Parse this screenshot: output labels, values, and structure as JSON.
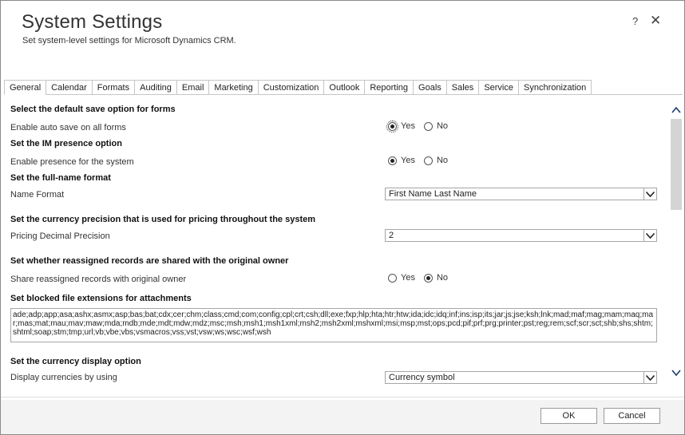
{
  "dialog": {
    "title": "System Settings",
    "subtitle": "Set system-level settings for Microsoft Dynamics CRM.",
    "help": "?",
    "close": "✕"
  },
  "tabs": [
    {
      "label": "General"
    },
    {
      "label": "Calendar"
    },
    {
      "label": "Formats"
    },
    {
      "label": "Auditing"
    },
    {
      "label": "Email"
    },
    {
      "label": "Marketing"
    },
    {
      "label": "Customization"
    },
    {
      "label": "Outlook"
    },
    {
      "label": "Reporting"
    },
    {
      "label": "Goals"
    },
    {
      "label": "Sales"
    },
    {
      "label": "Service"
    },
    {
      "label": "Synchronization"
    }
  ],
  "settings": {
    "autosave": {
      "heading": "Select the default save option for forms",
      "label": "Enable auto save on all forms",
      "yes": "Yes",
      "no": "No",
      "selected": "yes"
    },
    "presence": {
      "heading": "Set the IM presence option",
      "label": "Enable presence for the system",
      "yes": "Yes",
      "no": "No",
      "selected": "yes"
    },
    "fullname": {
      "heading": "Set the full-name format",
      "label": "Name Format",
      "value": "First Name Last Name"
    },
    "currency_precision": {
      "heading": "Set the currency precision that is used for pricing throughout the system",
      "label": "Pricing Decimal Precision",
      "value": "2"
    },
    "reassigned": {
      "heading": "Set whether reassigned records are shared with the original owner",
      "label": "Share reassigned records with original owner",
      "yes": "Yes",
      "no": "No",
      "selected": "no"
    },
    "blocked": {
      "heading": "Set blocked file extensions for attachments",
      "value": "ade;adp;app;asa;ashx;asmx;asp;bas;bat;cdx;cer;chm;class;cmd;com;config;cpl;crt;csh;dll;exe;fxp;hlp;hta;htr;htw;ida;idc;idq;inf;ins;isp;its;jar;js;jse;ksh;lnk;mad;maf;mag;mam;maq;mar;mas;mat;mau;mav;maw;mda;mdb;mde;mdt;mdw;mdz;msc;msh;msh1;msh1xml;msh2;msh2xml;mshxml;msi;msp;mst;ops;pcd;pif;prf;prg;printer;pst;reg;rem;scf;scr;sct;shb;shs;shtm;shtml;soap;stm;tmp;url;vb;vbe;vbs;vsmacros;vss;vst;vsw;ws;wsc;wsf;wsh"
    },
    "currency_display": {
      "heading": "Set the currency display option",
      "label": "Display currencies by using",
      "value": "Currency symbol"
    }
  },
  "footer": {
    "ok": "OK",
    "cancel": "Cancel"
  }
}
